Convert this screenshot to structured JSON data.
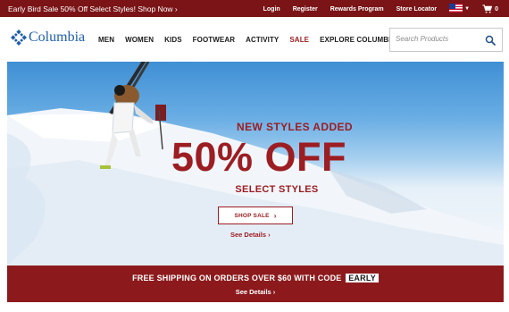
{
  "topbar": {
    "promo": "Early Bird Sale 50% Off Select Styles! Shop Now ›",
    "login": "Login",
    "register": "Register",
    "rewards": "Rewards Program",
    "store_locator": "Store Locator",
    "cart_count": "0",
    "flag_icon": "us-flag-icon",
    "cart_icon": "cart-icon"
  },
  "header": {
    "logo_text": "Columbia",
    "nav": [
      "MEN",
      "WOMEN",
      "KIDS",
      "FOOTWEAR",
      "ACTIVITY",
      "SALE",
      "EXPLORE COLUMBIA"
    ],
    "search_placeholder": "Search Products",
    "search_icon": "search-icon"
  },
  "hero": {
    "headline_small": "NEW STYLES ADDED",
    "headline_big": "50% OFF",
    "headline_sub": "SELECT STYLES",
    "cta_label": "SHOP SALE",
    "details_link": "See Details ›"
  },
  "shipping": {
    "text": "FREE SHIPPING ON ORDERS OVER $60 WITH CODE",
    "code": "EARLY",
    "details_link": "See Details ›"
  },
  "colors": {
    "brand_red": "#9c1d22",
    "topbar_bg": "#7a1416",
    "logo_blue": "#1f5fa8"
  }
}
